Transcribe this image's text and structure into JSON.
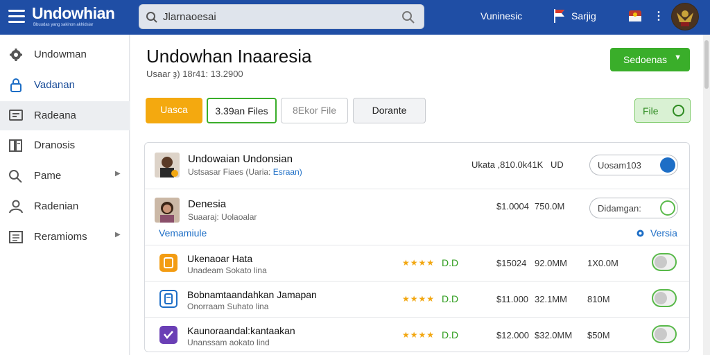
{
  "header": {
    "logo": "Undowhian",
    "logo_sub": "Bbuudas yang sakinon akhidsiar",
    "search_placeholder": "Jlarnaoesai",
    "nav_link": "Vuninesic",
    "nav_sign": "Sarjig"
  },
  "sidebar": {
    "items": [
      {
        "label": "Undowman",
        "icon": "gear-icon"
      },
      {
        "label": "Vadanan",
        "icon": "lock-icon"
      },
      {
        "label": "Radeana",
        "icon": "monitor-icon"
      },
      {
        "label": "Dranosis",
        "icon": "document-icon"
      },
      {
        "label": "Pame",
        "icon": "search-icon"
      },
      {
        "label": "Radenian",
        "icon": "user-icon"
      },
      {
        "label": "Reramioms",
        "icon": "list-icon"
      }
    ]
  },
  "main": {
    "title": "Undowhan Inaaresia",
    "subtitle": "Usaar ҙ) 18r41: 13.2900",
    "primary_button": "Sedoenas",
    "buttons": [
      "Uasca",
      "3.39an Files",
      "8Ekor File",
      "Dorante"
    ],
    "file_button": "File"
  },
  "rows": [
    {
      "name": "Undowaian Undonsian",
      "sub": "Ustsasar Fiaes (Uaria: ",
      "sub_link": "Esraan)",
      "amount": "Ukata ,810.0k41K",
      "currency": "UD",
      "pill": "Uosam103"
    },
    {
      "name": "Denesia",
      "sub": "Suaaraj: Uolaoalar",
      "amount": "$1.0004",
      "value": "750.0M",
      "pill": "Didamgan:"
    },
    {
      "section_link": "Vemamiule",
      "section_right": "Versia"
    },
    {
      "name": "Ukenaoar Hata",
      "sub": "Unadeam Sokato lina",
      "rating": "D.D",
      "price": "$15024",
      "size": "92.0MM",
      "extra": "1X0.0M"
    },
    {
      "name": "Bobnamtaandahkan Jamapan",
      "sub": "Onorraam Suhato lina",
      "rating": "D.D",
      "price": "$11.000",
      "size": "32.1MM",
      "extra": "810M"
    },
    {
      "name": "Kaunoraandal:kantaakan",
      "sub": "Unanssam aokato lind",
      "rating": "D.D",
      "price": "$12.000",
      "size": "$32.0MM",
      "extra": "$50M"
    }
  ],
  "colors": {
    "header": "#1f4ea5",
    "accent_green": "#3aae2a",
    "accent_orange": "#f4a90f",
    "link_blue": "#1d6ec6"
  }
}
